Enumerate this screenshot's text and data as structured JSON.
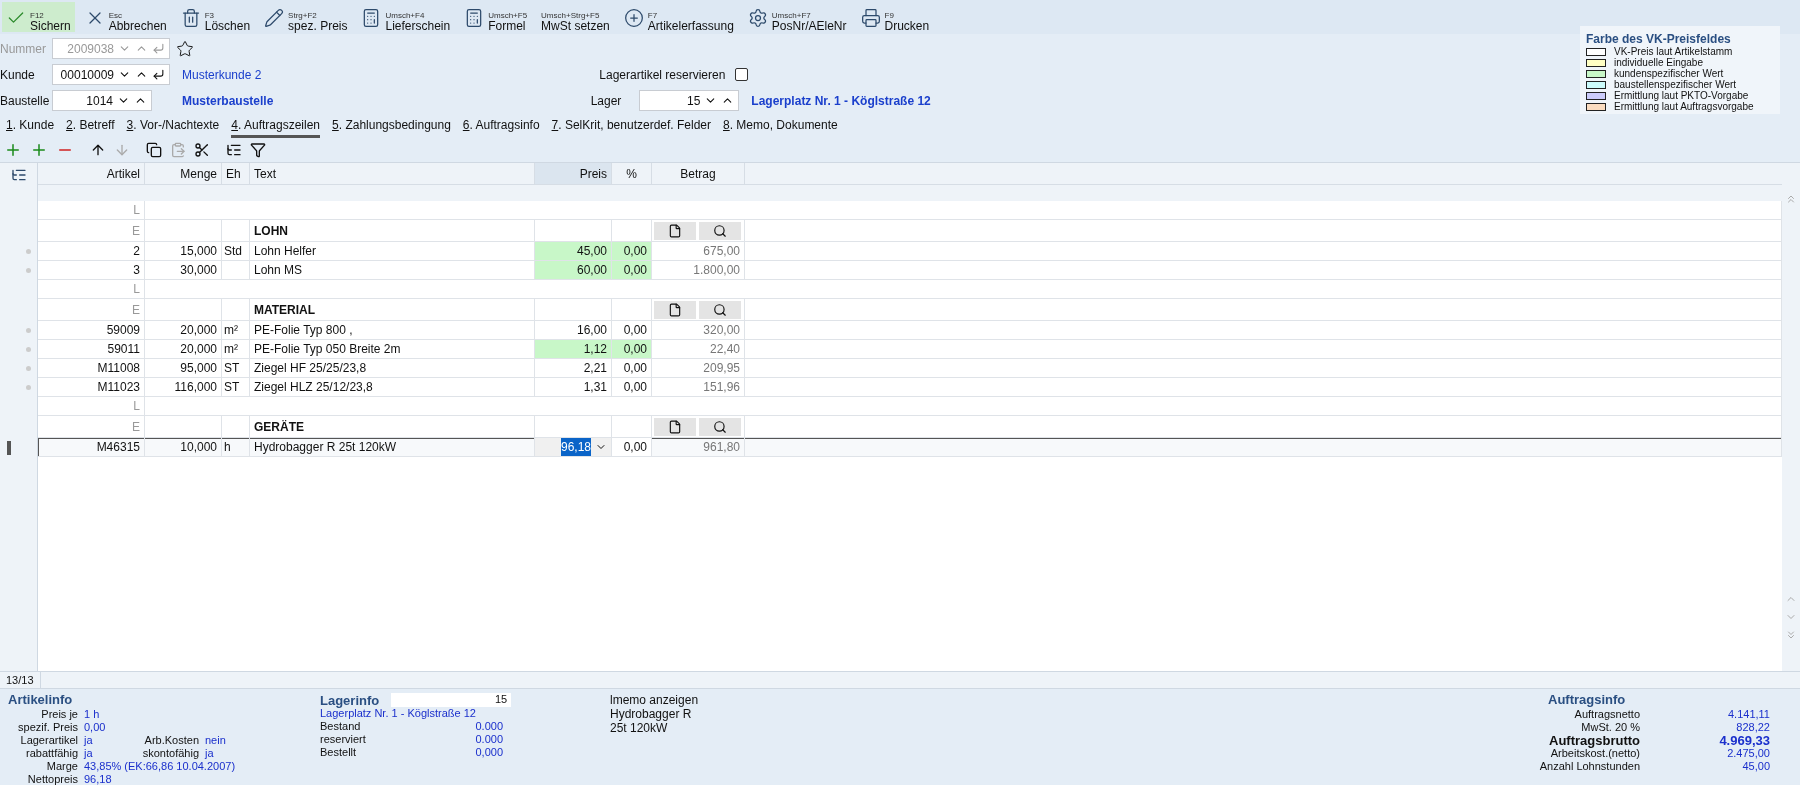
{
  "toolbar": [
    {
      "shortcut": "F12",
      "label": "Sichern",
      "highlighted": true
    },
    {
      "shortcut": "Esc",
      "label": "Abbrechen",
      "highlighted": false
    },
    {
      "shortcut": "F3",
      "label": "Löschen",
      "highlighted": false
    },
    {
      "shortcut": "Strg+F2",
      "label": "spez. Preis",
      "highlighted": false
    },
    {
      "shortcut": "Umsch+F4",
      "label": "Lieferschein",
      "highlighted": false
    },
    {
      "shortcut": "Umsch+F5",
      "label": "Formel",
      "highlighted": false
    },
    {
      "shortcut": "Umsch+Strg+F5",
      "label": "MwSt setzen",
      "highlighted": false
    },
    {
      "shortcut": "F7",
      "label": "Artikelerfassung",
      "highlighted": false
    },
    {
      "shortcut": "Umsch+F7",
      "label": "PosNr/AEleNr",
      "highlighted": false
    },
    {
      "shortcut": "F9",
      "label": "Drucken",
      "highlighted": false
    }
  ],
  "header": {
    "nummer": {
      "label": "Nummer",
      "value": "2009038",
      "disabled": true
    },
    "kunde": {
      "label": "Kunde",
      "value": "00010009",
      "link": "Musterkunde 2"
    },
    "baustelle": {
      "label": "Baustelle",
      "value": "1014",
      "link": "Musterbaustelle"
    },
    "reserve": {
      "label": "Lagerartikel reservieren",
      "checked": false
    },
    "lager": {
      "label": "Lager",
      "value": "15",
      "link": "Lagerplatz Nr. 1 - Köglstraße 12"
    }
  },
  "legend": {
    "title": "Farbe des VK-Preisfeldes",
    "items": [
      {
        "label": "VK-Preis laut Artikelstamm",
        "color": "#ffffff"
      },
      {
        "label": "individuelle Eingabe",
        "color": "#ffffc4"
      },
      {
        "label": "kundenspezifischer Wert",
        "color": "#c8f7c8"
      },
      {
        "label": "baustellenspezifischer Wert",
        "color": "#ccfbfb"
      },
      {
        "label": "Ermittlung laut PKTO-Vorgabe",
        "color": "#ccccfb"
      },
      {
        "label": "Ermittlung laut Auftragsvorgabe",
        "color": "#fbdcc0"
      }
    ]
  },
  "tabs": [
    {
      "label": "1. Kunde",
      "selected": false
    },
    {
      "label": "2. Betreff",
      "selected": false
    },
    {
      "label": "3. Vor-/Nachtexte",
      "selected": false
    },
    {
      "label": "4. Auftragszeilen",
      "selected": true
    },
    {
      "label": "5. Zahlungsbedingung",
      "selected": false
    },
    {
      "label": "6. Auftragsinfo",
      "selected": false
    },
    {
      "label": "7. SelKrit, benutzerdef. Felder",
      "selected": false
    },
    {
      "label": "8. Memo, Dokumente",
      "selected": false
    }
  ],
  "table": {
    "columns": [
      "Artikel",
      "Menge",
      "Eh",
      "Text",
      "Preis",
      "%",
      "Betrag"
    ],
    "rows": [
      {
        "kind": "marker",
        "code": "L"
      },
      {
        "kind": "heading",
        "code": "E",
        "text": "LOHN"
      },
      {
        "kind": "item",
        "artikel": "2",
        "menge": "15,000",
        "eh": "Std",
        "text": "Lohn Helfer",
        "preis": "45,00",
        "pct": "0,00",
        "betrag": "675,00",
        "color": "#c8f7c8",
        "selected": false
      },
      {
        "kind": "item",
        "artikel": "3",
        "menge": "30,000",
        "text": "Lohn MS",
        "preis": "60,00",
        "pct": "0,00",
        "betrag": "1.800,00",
        "color": "#c8f7c8",
        "selected": false
      },
      {
        "kind": "marker",
        "code": "L"
      },
      {
        "kind": "heading",
        "code": "E",
        "text": "MATERIAL"
      },
      {
        "kind": "item",
        "artikel": "59009",
        "menge": "20,000",
        "eh": "m²",
        "text": "PE-Folie Typ 800 ,",
        "preis": "16,00",
        "pct": "0,00",
        "betrag": "320,00",
        "color": "#ffffff",
        "selected": false
      },
      {
        "kind": "item",
        "artikel": "59011",
        "menge": "20,000",
        "eh": "m²",
        "text": "PE-Folie Typ 050 Breite 2m",
        "preis": "1,12",
        "pct": "0,00",
        "betrag": "22,40",
        "color": "#c8f7c8",
        "selected": false
      },
      {
        "kind": "item",
        "artikel": "M11008",
        "menge": "95,000",
        "eh": "ST",
        "text": "Ziegel HF 25/25/23,8",
        "preis": "2,21",
        "pct": "0,00",
        "betrag": "209,95",
        "color": "#ffffff",
        "selected": false
      },
      {
        "kind": "item",
        "artikel": "M11023",
        "menge": "116,000",
        "eh": "ST",
        "text": "Ziegel HLZ 25/12/23,8",
        "preis": "1,31",
        "pct": "0,00",
        "betrag": "151,96",
        "color": "#ffffff",
        "selected": false
      },
      {
        "kind": "marker",
        "code": "L"
      },
      {
        "kind": "heading",
        "code": "E",
        "text": "GERÄTE"
      },
      {
        "kind": "item",
        "artikel": "M46315",
        "menge": "10,000",
        "eh": "h",
        "text": "Hydrobagger R 25t 120kW",
        "preis": "96,18",
        "pct": "0,00",
        "betrag": "961,80",
        "color": "#ffffff",
        "selected": true
      }
    ]
  },
  "status_bar": {
    "count": "13/13"
  },
  "artikelinfo": {
    "title": "Artikelinfo",
    "rows": [
      [
        {
          "label": "Preis je",
          "value": "1 h"
        }
      ],
      [
        {
          "label": "spezif. Preis",
          "value": "0,00"
        }
      ],
      [
        {
          "label": "Lagerartikel",
          "value": "ja"
        },
        {
          "label": "Arb.Kosten",
          "value": "nein"
        }
      ],
      [
        {
          "label": "rabattfähig",
          "value": "ja"
        },
        {
          "label": "skontofähig",
          "value": "ja"
        }
      ],
      [
        {
          "label": "Marge",
          "value": "43,85% (EK:66,86  10.04.2007)"
        }
      ],
      [
        {
          "label": "Nettopreis",
          "value": "96,18"
        }
      ]
    ]
  },
  "lagerinfo": {
    "title": "Lagerinfo",
    "field": "15",
    "place": "Lagerplatz Nr. 1 - Köglstraße 12",
    "rows": [
      {
        "label": "Bestand",
        "value": "0.000"
      },
      {
        "label": "reserviert",
        "value": "0.000"
      },
      {
        "label": "Bestellt",
        "value": "0,000"
      }
    ],
    "memo_label": "lmemo anzeigen",
    "memo_text": "Hydrobagger R 25t 120kW"
  },
  "auftragsinfo": {
    "title": "Auftragsinfo",
    "rows": [
      {
        "label": "Auftragsnetto",
        "value": "4.141,11",
        "bold": false
      },
      {
        "label": "MwSt. 20 %",
        "value": "828,22",
        "bold": false
      },
      {
        "label": "Auftragsbrutto",
        "value": "4.969,33",
        "bold": true
      },
      {
        "label": "Arbeitskost.(netto)",
        "value": "2.475,00",
        "bold": false
      },
      {
        "label": "Anzahl Lohnstunden",
        "value": "45,00",
        "bold": false
      }
    ]
  }
}
